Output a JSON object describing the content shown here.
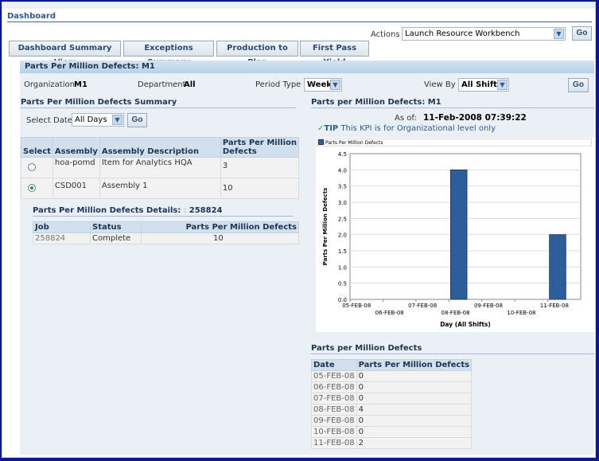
{
  "header": {
    "title": "Dashboard",
    "actions_label": "Actions",
    "actions_value": "Launch Resource Workbench",
    "go_label": "Go"
  },
  "tabs": [
    {
      "label": "Dashboard Summary View"
    },
    {
      "label": "Exceptions Summary"
    },
    {
      "label": "Production to Plan"
    },
    {
      "label": "First Pass Yield"
    }
  ],
  "panel": {
    "title": "Parts Per Million Defects: M1",
    "organization_label": "Organization",
    "organization_value": "M1",
    "department_label": "Department",
    "department_value": "All",
    "period_type_label": "Period Type",
    "period_type_value": "Week",
    "view_by_label": "View By",
    "view_by_value": "All Shifts",
    "go_label": "Go"
  },
  "summary": {
    "title": "Parts Per Million Defects Summary",
    "select_date_label": "Select Date",
    "select_date_value": "All Days",
    "go_label": "Go",
    "columns": [
      "Select",
      "Assembly",
      "Assembly Description",
      "Parts Per Million Defects"
    ],
    "rows": [
      {
        "selected": false,
        "assembly": "hoa-pomd",
        "description": "Item for  Analytics HQA",
        "ppm": "3"
      },
      {
        "selected": true,
        "assembly": "CSD001",
        "description": "Assembly 1",
        "ppm": "10"
      }
    ]
  },
  "details": {
    "title": "Parts Per Million Defects Details:",
    "job_id": "258824",
    "columns": [
      "Job",
      "Status",
      "Parts Per Million Defects"
    ],
    "rows": [
      {
        "job": "258824",
        "status": "Complete",
        "ppm": "10"
      }
    ]
  },
  "kpi": {
    "title": "Parts per Million Defects: M1",
    "as_of_label": "As of:",
    "as_of_value": "11-Feb-2008 07:39:22",
    "tip_label": "TIP",
    "tip_text": "This KPI is for Organizational level only",
    "colors": {
      "bar": "#2e5e9a",
      "tip": "#2d5a8c"
    }
  },
  "chart_data": {
    "type": "bar",
    "title": "",
    "legend": [
      "Parts Per Million Defects"
    ],
    "legend_position": "top",
    "categories": [
      "05-FEB-08",
      "06-FEB-08",
      "07-FEB-08",
      "08-FEB-08",
      "09-FEB-08",
      "10-FEB-08",
      "11-FEB-08"
    ],
    "values": [
      0,
      0,
      0,
      4,
      0,
      0,
      2
    ],
    "xlabel": "Day (All Shifts)",
    "ylabel": "Parts Per Million Defects",
    "ylim": [
      0,
      4.5
    ],
    "yticks": [
      "0.0",
      "0.5",
      "1.0",
      "1.5",
      "2.0",
      "2.5",
      "3.0",
      "3.5",
      "4.0",
      "4.5"
    ],
    "grid": true
  },
  "ppm_table": {
    "title": "Parts per Million Defects",
    "columns": [
      "Date",
      "Parts Per Million Defects"
    ],
    "rows": [
      {
        "date": "05-FEB-08",
        "value": "0"
      },
      {
        "date": "06-FEB-08",
        "value": "0"
      },
      {
        "date": "07-FEB-08",
        "value": "0"
      },
      {
        "date": "08-FEB-08",
        "value": "4"
      },
      {
        "date": "09-FEB-08",
        "value": "0"
      },
      {
        "date": "10-FEB-08",
        "value": "0"
      },
      {
        "date": "11-FEB-08",
        "value": "2"
      }
    ]
  }
}
